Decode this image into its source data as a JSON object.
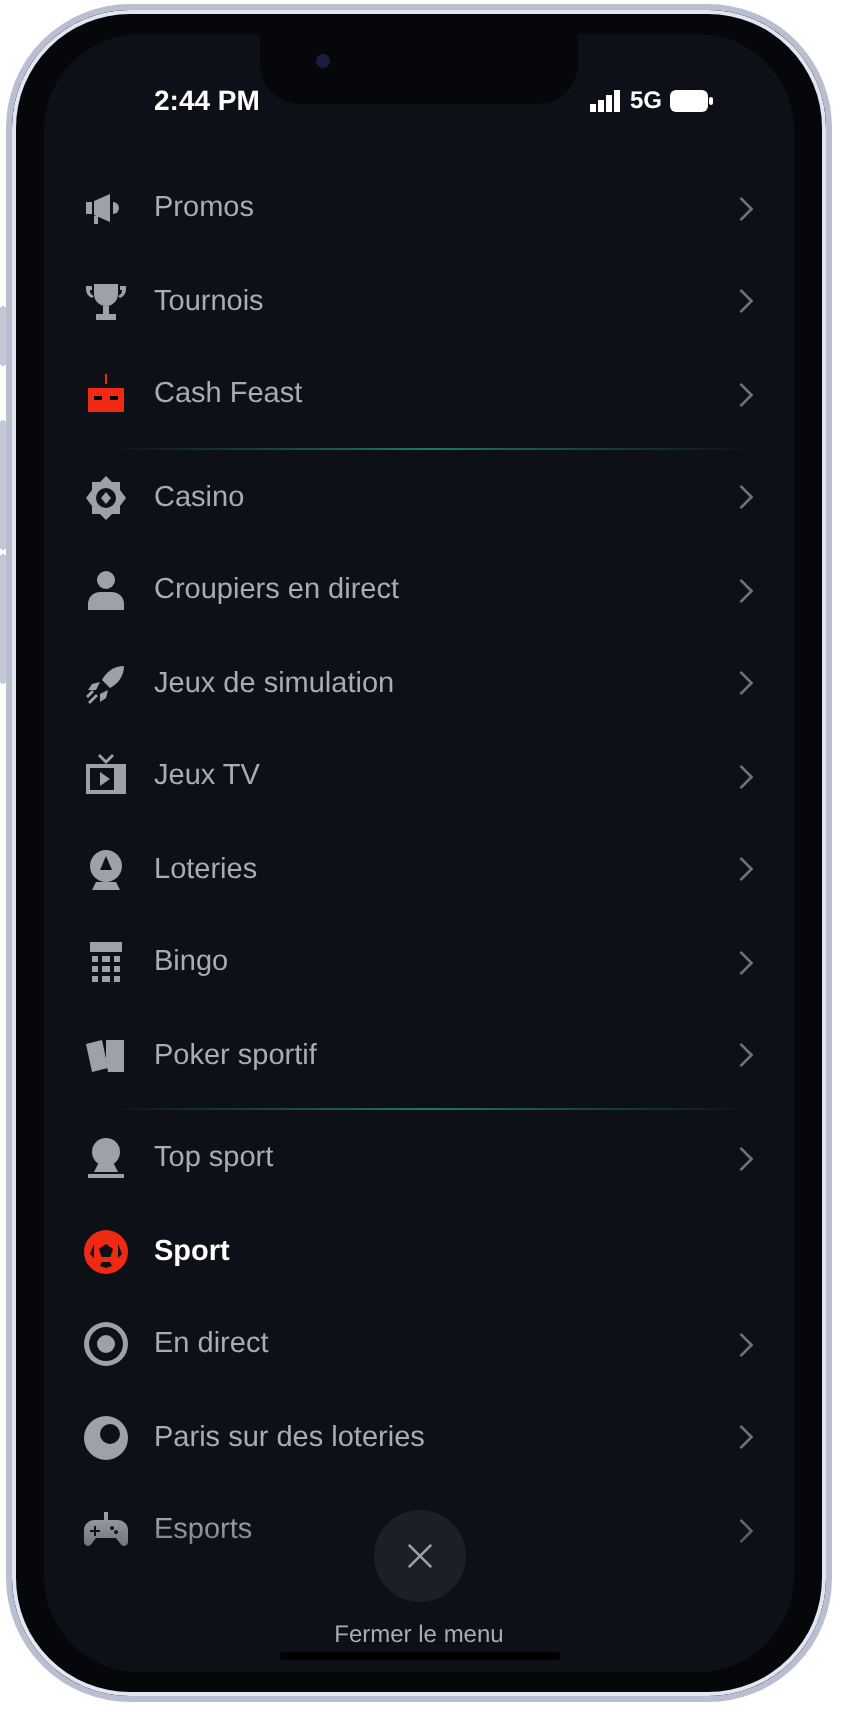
{
  "status_bar": {
    "time": "2:44 PM",
    "network": "5G"
  },
  "menu": {
    "sections": [
      {
        "items": [
          {
            "label": "Promos",
            "selected": false
          },
          {
            "label": "Tournois",
            "selected": false
          },
          {
            "label": "Cash Feast",
            "selected": false
          }
        ]
      },
      {
        "items": [
          {
            "label": "Casino",
            "selected": false
          },
          {
            "label": "Croupiers en direct",
            "selected": false
          },
          {
            "label": "Jeux de simulation",
            "selected": false
          },
          {
            "label": "Jeux TV",
            "selected": false
          },
          {
            "label": "Loteries",
            "selected": false
          },
          {
            "label": "Bingo",
            "selected": false
          },
          {
            "label": "Poker sportif",
            "selected": false
          }
        ]
      },
      {
        "items": [
          {
            "label": "Top sport",
            "selected": false
          },
          {
            "label": "Sport",
            "selected": true
          },
          {
            "label": "En direct",
            "selected": false
          },
          {
            "label": "Paris sur des loteries",
            "selected": false
          },
          {
            "label": "Esports",
            "selected": false
          }
        ]
      }
    ]
  },
  "close_button": {
    "label": "Fermer le menu"
  }
}
